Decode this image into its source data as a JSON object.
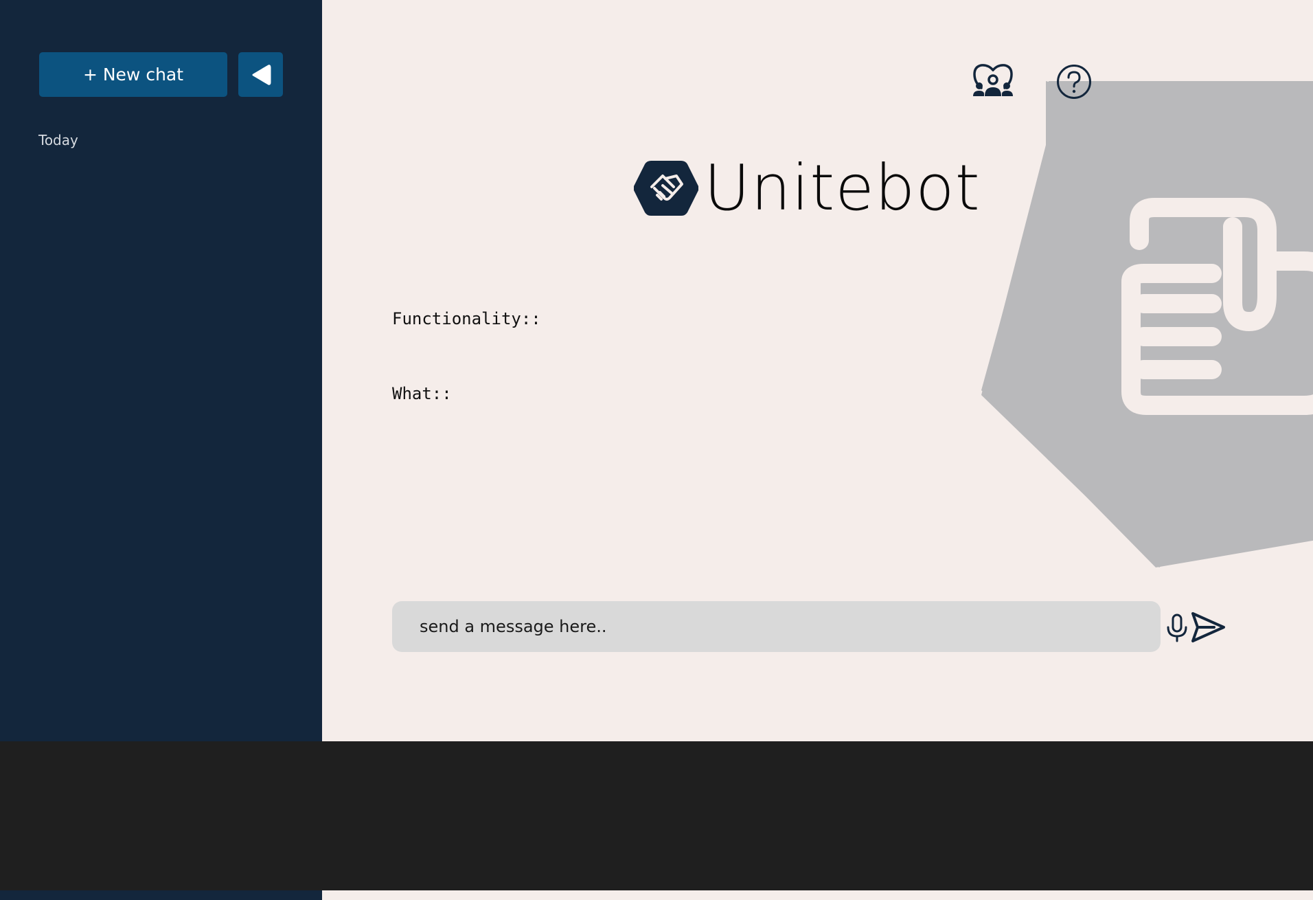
{
  "sidebar": {
    "new_chat_label": "+ New chat",
    "collapse_icon": "triangle-left-icon",
    "section_today": "Today"
  },
  "header": {
    "community_icon": "group-heart-icon",
    "help_icon": "question-circle-icon"
  },
  "brand": {
    "name": "Unitebot",
    "logo_icon": "handshake-hexagon-icon"
  },
  "content": {
    "functionality_label": "Functionality::",
    "what_label": "What::"
  },
  "composer": {
    "placeholder": "send a message here..",
    "mic_icon": "microphone-icon",
    "send_icon": "send-arrow-icon"
  },
  "colors": {
    "sidebar_bg": "#13263c",
    "button_bg": "#0c5380",
    "main_bg": "#f5edea",
    "watermark": "#b9b9bb",
    "input_bg": "#d9d9d9",
    "bottom_band": "#1f1f1f"
  }
}
